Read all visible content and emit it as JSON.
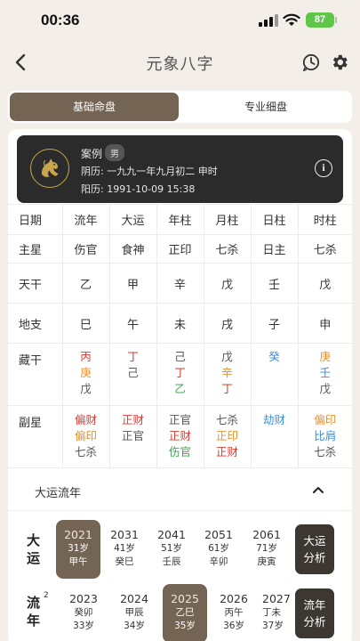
{
  "status_bar": {
    "time": "00:36",
    "battery": "87"
  },
  "nav": {
    "title": "元象八字"
  },
  "tabs": [
    {
      "label": "基础命盘",
      "active": true
    },
    {
      "label": "专业细盘",
      "active": false
    }
  ],
  "profile": {
    "name": "案例",
    "gender": "男",
    "lunar": "阴历: 一九九一年九月初二 申时",
    "solar": "阳历: 1991-10-09 15:38",
    "info_glyph": "i"
  },
  "table": {
    "headers": [
      "日期",
      "流年",
      "大运",
      "年柱",
      "月柱",
      "日柱",
      "时柱"
    ],
    "main_star": {
      "label": "主星",
      "values": [
        "伤官",
        "食神",
        "正印",
        "七杀",
        "日主",
        "七杀"
      ]
    },
    "tiangan": {
      "label": "天干",
      "values": [
        "乙",
        "甲",
        "辛",
        "戊",
        "壬",
        "戊"
      ]
    },
    "dizhi": {
      "label": "地支",
      "values": [
        "巳",
        "午",
        "未",
        "戌",
        "子",
        "申"
      ]
    },
    "canggan": {
      "label": "藏干",
      "values": [
        [
          "丙",
          "庚",
          "戊"
        ],
        [
          "丁",
          "己"
        ],
        [
          "己",
          "丁",
          "乙"
        ],
        [
          "戊",
          "辛",
          "丁"
        ],
        [
          "癸"
        ],
        [
          "庚",
          "壬",
          "戊"
        ]
      ]
    },
    "fuxing": {
      "label": "副星",
      "values": [
        [
          "偏财",
          "偏印",
          "七杀"
        ],
        [
          "正财",
          "正官"
        ],
        [
          "正官",
          "正财",
          "伤官"
        ],
        [
          "七杀",
          "正印",
          "正财"
        ],
        [
          "劫财"
        ],
        [
          "偏印",
          "比肩",
          "七杀"
        ]
      ]
    }
  },
  "dayun_section": {
    "title": "大运流年",
    "dayun_label": [
      "大",
      "运"
    ],
    "dayun": [
      {
        "year": "2021",
        "age": "31岁",
        "ganzhi": "甲午",
        "selected": true
      },
      {
        "year": "2031",
        "age": "41岁",
        "ganzhi": "癸巳",
        "selected": false
      },
      {
        "year": "2041",
        "age": "51岁",
        "ganzhi": "壬辰",
        "selected": false
      },
      {
        "year": "2051",
        "age": "61岁",
        "ganzhi": "辛卯",
        "selected": false
      },
      {
        "year": "2061",
        "age": "71岁",
        "ganzhi": "庚寅",
        "selected": false
      }
    ],
    "dayun_button": [
      "大运",
      "分析"
    ],
    "liunian_label": [
      "流",
      "年"
    ],
    "liunian_sup": "2",
    "liunian": [
      {
        "year": "2023",
        "ganzhi": "癸卯",
        "age": "33岁",
        "selected": false
      },
      {
        "year": "2024",
        "ganzhi": "甲辰",
        "age": "34岁",
        "selected": false
      },
      {
        "year": "2025",
        "ganzhi": "乙巳",
        "age": "35岁",
        "selected": true
      },
      {
        "year": "2026",
        "ganzhi": "丙午",
        "age": "36岁",
        "selected": false
      },
      {
        "year": "2027",
        "ganzhi": "丁未",
        "age": "37岁",
        "selected": false
      }
    ],
    "liunian_button": [
      "流年",
      "分析"
    ]
  },
  "colors": {
    "accent": "#746453",
    "header_bg": "#2b2b2b",
    "page_bg": "#f3efe8"
  }
}
